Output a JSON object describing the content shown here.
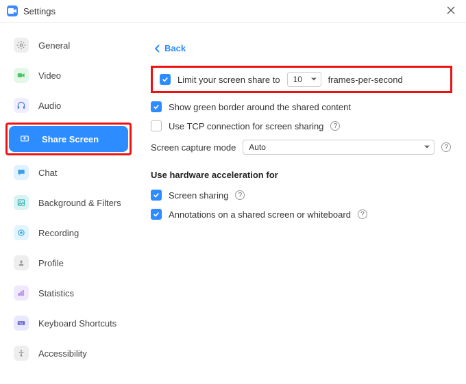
{
  "window": {
    "title": "Settings"
  },
  "sidebar": {
    "items": [
      {
        "label": "General"
      },
      {
        "label": "Video"
      },
      {
        "label": "Audio"
      },
      {
        "label": "Share Screen"
      },
      {
        "label": "Chat"
      },
      {
        "label": "Background & Filters"
      },
      {
        "label": "Recording"
      },
      {
        "label": "Profile"
      },
      {
        "label": "Statistics"
      },
      {
        "label": "Keyboard Shortcuts"
      },
      {
        "label": "Accessibility"
      }
    ]
  },
  "content": {
    "back": "Back",
    "limit_prefix": "Limit your screen share to",
    "limit_value": "10",
    "limit_suffix": "frames-per-second",
    "green_border": "Show green border around the shared content",
    "tcp": "Use TCP connection for screen sharing",
    "capture_mode_label": "Screen capture mode",
    "capture_mode_value": "Auto",
    "hw_accel_title": "Use hardware acceleration for",
    "hw_share": "Screen sharing",
    "hw_annot": "Annotations on a shared screen or whiteboard",
    "help": "?"
  }
}
